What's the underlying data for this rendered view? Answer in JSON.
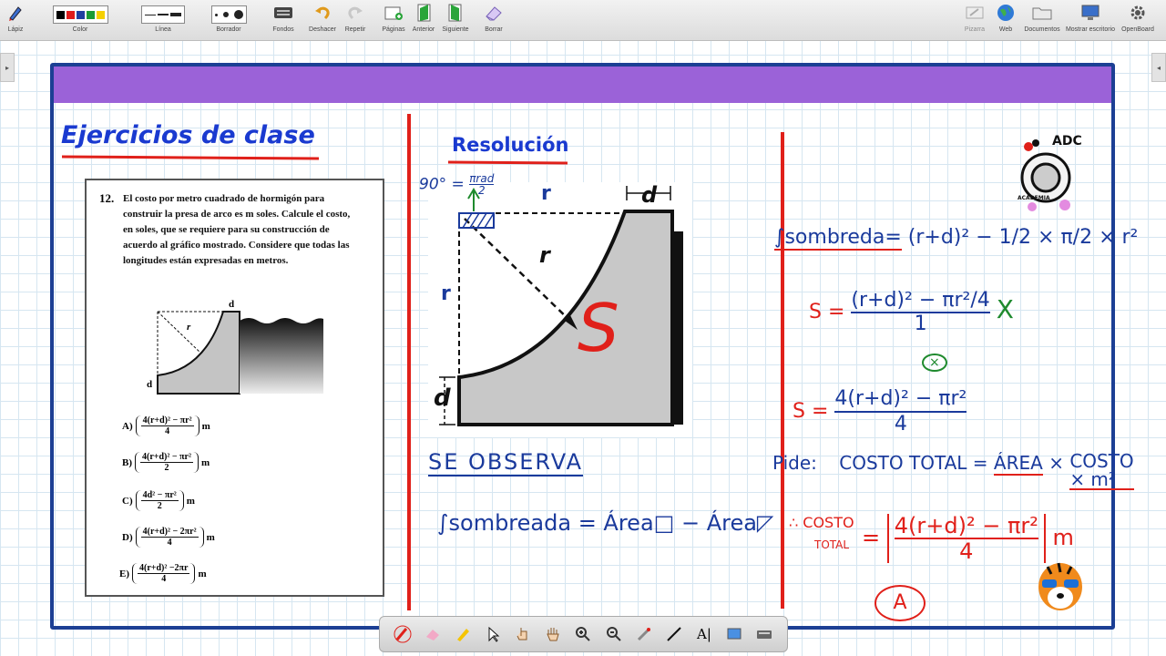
{
  "toolbar": {
    "pen_label": "Lápiz",
    "color_label": "Color",
    "line_label": "Línea",
    "eraser_label": "Borrador",
    "backgrounds_label": "Fondos",
    "undo_label": "Deshacer",
    "redo_label": "Repetir",
    "pages_label": "Páginas",
    "previous_label": "Anterior",
    "next_label": "Siguiente",
    "erase_label": "Borrar",
    "board_label": "Pizarra",
    "web_label": "Web",
    "documents_label": "Documentos",
    "desktop_label": "Mostrar escritorio",
    "openboard_label": "OpenBoard",
    "colors": [
      "#000000",
      "#e01b1b",
      "#1f3fa0",
      "#1a9b34",
      "#f5d000"
    ]
  },
  "board": {
    "title": "Ejercicios de clase",
    "resolution_title": "Resolución",
    "logo_text": "ADC",
    "logo_sub": "ACADEMIA"
  },
  "problem": {
    "number": "12.",
    "text": "El costo por metro cuadrado de hormigón para construir la presa de arco es m soles. Calcule el costo, en soles, que se requiere para su construcción de acuerdo al gráfico mostrado. Considere que todas las longitudes están expresadas en metros.",
    "figure_labels": {
      "d_top": "d",
      "r": "r",
      "d_side": "d"
    },
    "options": [
      {
        "letter": "A)",
        "num": "4(r+d)² − πr²",
        "den": "4",
        "unit": "m"
      },
      {
        "letter": "B)",
        "num": "4(r+d)² − πr²",
        "den": "2",
        "unit": "m"
      },
      {
        "letter": "C)",
        "num": "4d² − πr²",
        "den": "2",
        "unit": "m"
      },
      {
        "letter": "D)",
        "num": "4(r+d)² − 2πr²",
        "den": "4",
        "unit": "m"
      },
      {
        "letter": "E)",
        "num": "4(r+d)² −2πr",
        "den": "4",
        "unit": "m"
      }
    ]
  },
  "diagram": {
    "angle_num": "πrad",
    "angle_prefix": "90° =",
    "angle_den": "2",
    "label_r_top": "r",
    "label_r_diag": "r",
    "label_r_left": "r",
    "label_d_top": "d",
    "label_d_side": "d",
    "shaded_symbol": "S"
  },
  "notes": {
    "se_observa": "SE OBSERVA",
    "eq1": "∫sombreada = Área□ − Área◸",
    "eq2_left": "∫sombreda=",
    "eq2_right": "(r+d)² − 1/2 × π/2 × r²",
    "eq3_left": "S =",
    "eq3_num": "(r+d)² − πr²/4",
    "eq3_den": "1",
    "eq3_mult": "X",
    "eq3_under": "×",
    "eq4_left": "S =",
    "eq4_num": "4(r+d)² − πr²",
    "eq4_den": "4",
    "pide_label": "Pide:",
    "pide_text": "COSTO TOTAL =",
    "pide_area": "ÁREA",
    "pide_times": "×",
    "pide_cost": "COSTO",
    "pide_cost_unit": "× m²",
    "result_label1": "∴ COSTO",
    "result_label2": "TOTAL",
    "result_eq": "=",
    "result_num": "4(r+d)² − πr²",
    "result_den": "4",
    "result_unit": "m",
    "answer": "A"
  }
}
